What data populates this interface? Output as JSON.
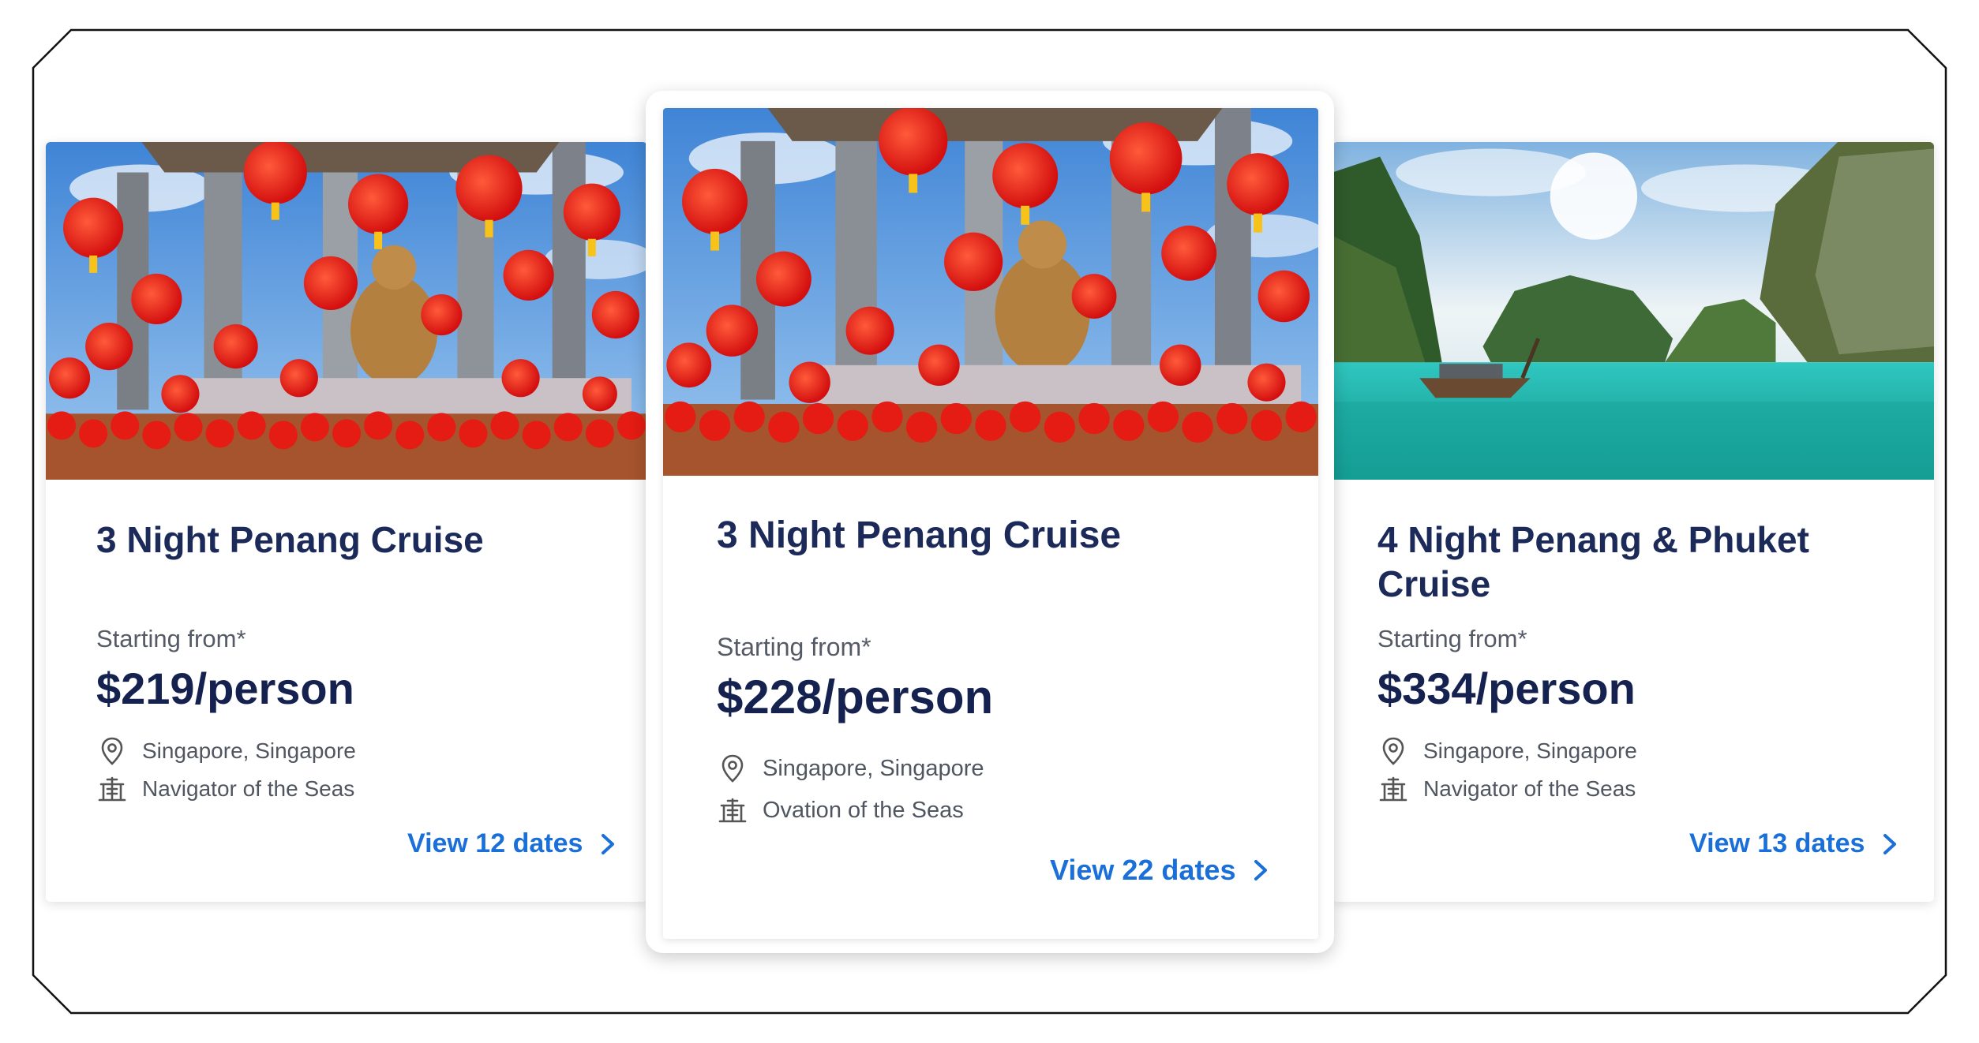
{
  "cards": [
    {
      "title": "3 Night Penang Cruise",
      "starting_from_label": "Starting from*",
      "price": "$219/person",
      "port": "Singapore, Singapore",
      "ship": "Navigator of the Seas",
      "view_dates": "View 12 dates",
      "image": "penang-lanterns-temple",
      "location_icon": "location-pin-icon",
      "ship_icon": "ship-icon",
      "link_icon": "chevron-right-icon"
    },
    {
      "title": "3 Night Penang Cruise",
      "starting_from_label": "Starting from*",
      "price": "$228/person",
      "port": "Singapore, Singapore",
      "ship": "Ovation of the Seas",
      "view_dates": "View 22 dates",
      "image": "penang-lanterns-temple",
      "location_icon": "location-pin-icon",
      "ship_icon": "ship-icon",
      "link_icon": "chevron-right-icon"
    },
    {
      "title": "4 Night Penang & Phuket Cruise",
      "starting_from_label": "Starting from*",
      "price": "$334/person",
      "port": "Singapore, Singapore",
      "ship": "Navigator of the Seas",
      "view_dates": "View 13 dates",
      "image": "phuket-bay-longtail-boat",
      "location_icon": "location-pin-icon",
      "ship_icon": "ship-icon",
      "link_icon": "chevron-right-icon"
    }
  ],
  "colors": {
    "title": "#1c2a5a",
    "price": "#15214f",
    "link": "#1a6fd8",
    "meta": "#505660"
  }
}
